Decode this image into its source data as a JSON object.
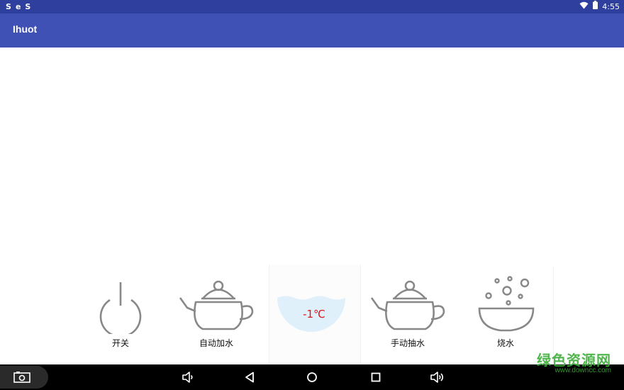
{
  "status_bar": {
    "left_icons": [
      "S",
      "e",
      "S"
    ],
    "time": "4:55",
    "icons": [
      "wifi-icon",
      "battery-icon"
    ]
  },
  "app_bar": {
    "title": "Ihuot"
  },
  "tools": [
    {
      "label": "开关",
      "icon": "power-icon"
    },
    {
      "label": "自动加水",
      "icon": "teapot-icon"
    },
    {
      "label": "手动抽水",
      "icon": "teapot-icon"
    },
    {
      "label": "烧水",
      "icon": "boiling-bowl-icon"
    }
  ],
  "temperature": {
    "value": "-1℃",
    "color": "#e0141b",
    "fill_color": "#dff0fb"
  },
  "nav_bar": {
    "buttons": [
      "screenshot-icon",
      "volume-down-icon",
      "back-icon",
      "home-icon",
      "recents-icon",
      "volume-up-icon"
    ]
  },
  "watermark": {
    "main": "绿色资源网",
    "sub": "www.downcc.com"
  },
  "colors": {
    "status_bar": "#2f3f9e",
    "app_bar": "#3f51b5",
    "icon_gray": "#888888"
  }
}
